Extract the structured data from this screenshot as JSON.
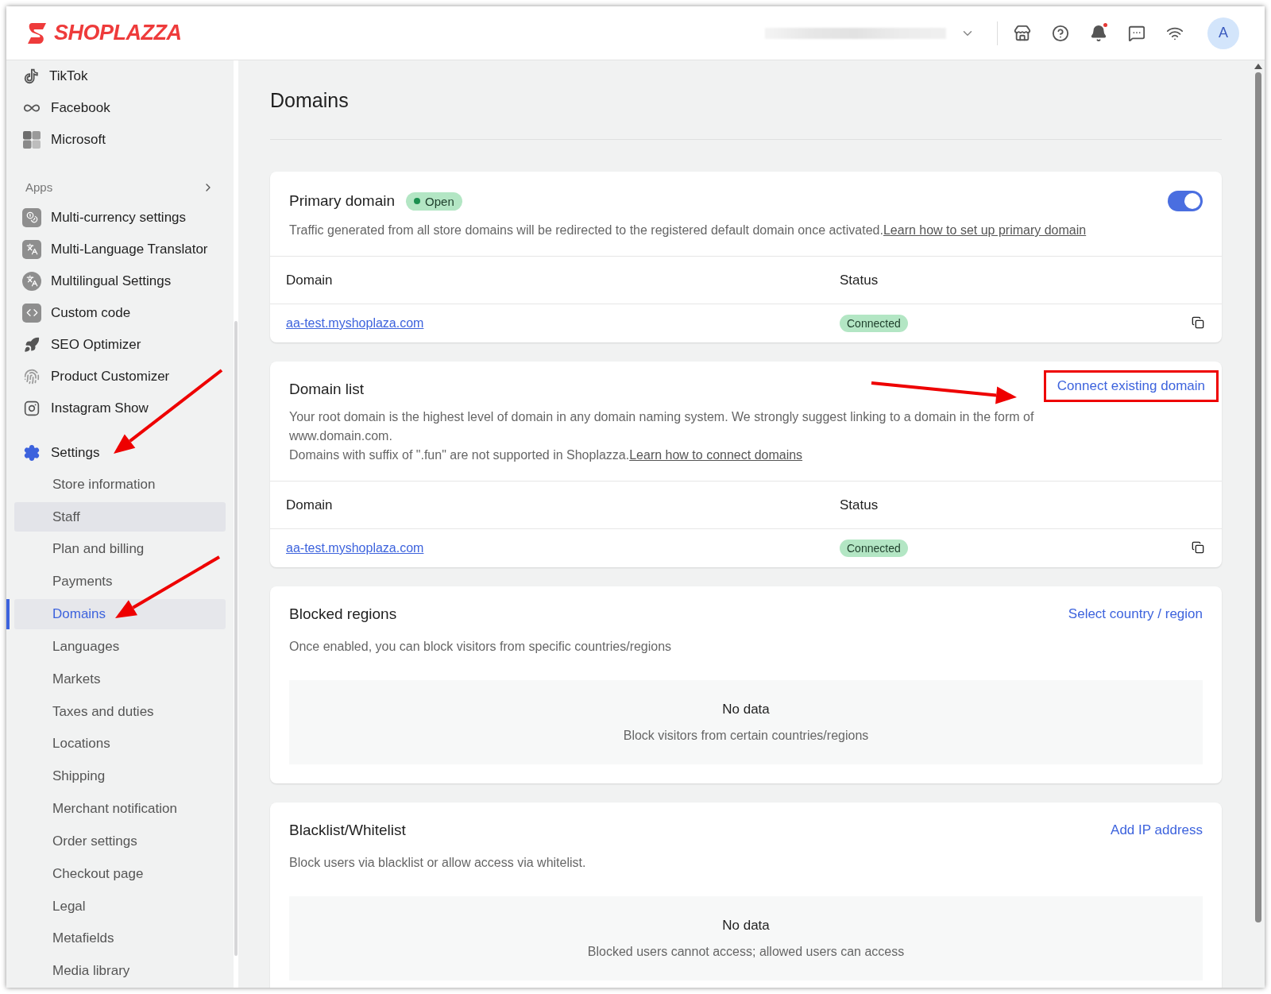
{
  "header": {
    "logo": "SHOPLAZZA",
    "notification_dot": true,
    "avatar": "A"
  },
  "sidebar": {
    "channels": [
      {
        "label": "TikTok"
      },
      {
        "label": "Facebook"
      },
      {
        "label": "Microsoft"
      }
    ],
    "apps_heading": "Apps",
    "apps": [
      {
        "label": "Multi-currency settings"
      },
      {
        "label": "Multi-Language Translator"
      },
      {
        "label": "Multilingual Settings"
      },
      {
        "label": "Custom code"
      },
      {
        "label": "SEO Optimizer"
      },
      {
        "label": "Product Customizer"
      },
      {
        "label": "Instagram Show"
      }
    ],
    "settings": {
      "label": "Settings",
      "items": [
        {
          "label": "Store information",
          "selected": false,
          "highlighted": false
        },
        {
          "label": "Staff",
          "selected": false,
          "highlighted": true
        },
        {
          "label": "Plan and billing",
          "selected": false,
          "highlighted": false
        },
        {
          "label": "Payments",
          "selected": false,
          "highlighted": false
        },
        {
          "label": "Domains",
          "selected": true,
          "highlighted": false
        },
        {
          "label": "Languages",
          "selected": false,
          "highlighted": false
        },
        {
          "label": "Markets",
          "selected": false,
          "highlighted": false
        },
        {
          "label": "Taxes and duties",
          "selected": false,
          "highlighted": false
        },
        {
          "label": "Locations",
          "selected": false,
          "highlighted": false
        },
        {
          "label": "Shipping",
          "selected": false,
          "highlighted": false
        },
        {
          "label": "Merchant notification",
          "selected": false,
          "highlighted": false
        },
        {
          "label": "Order settings",
          "selected": false,
          "highlighted": false
        },
        {
          "label": "Checkout page",
          "selected": false,
          "highlighted": false
        },
        {
          "label": "Legal",
          "selected": false,
          "highlighted": false
        },
        {
          "label": "Metafields",
          "selected": false,
          "highlighted": false
        },
        {
          "label": "Media library",
          "selected": false,
          "highlighted": false
        }
      ]
    }
  },
  "page": {
    "title": "Domains"
  },
  "primary_domain": {
    "title": "Primary domain",
    "badge": "Open",
    "on": true,
    "description": "Traffic generated from all store domains will be redirected to the registered default domain once activated.",
    "link": "Learn how to set up primary domain",
    "columns": [
      "Domain",
      "Status"
    ],
    "rows": [
      {
        "domain": "aa-test.myshoplaza.com",
        "status": "Connected"
      }
    ]
  },
  "domain_list": {
    "title": "Domain list",
    "action": "Connect existing domain",
    "action_highlighted": true,
    "description": "Your root domain is the highest level of domain in any domain naming system. We strongly suggest linking to a domain in the form of www.domain.com.",
    "note": "Domains with suffix of \".fun\" are not supported in Shoplazza.",
    "link": "Learn how to connect domains",
    "columns": [
      "Domain",
      "Status"
    ],
    "rows": [
      {
        "domain": "aa-test.myshoplaza.com",
        "status": "Connected"
      }
    ]
  },
  "blocked_regions": {
    "title": "Blocked regions",
    "action": "Select country / region",
    "description": "Once enabled, you can block visitors from specific countries/regions",
    "empty_title": "No data",
    "empty_text": "Block visitors from certain countries/regions"
  },
  "blacklist": {
    "title": "Blacklist/Whitelist",
    "action": "Add IP address",
    "description": "Block users via blacklist or allow access via whitelist.",
    "empty_title": "No data",
    "empty_text": "Blocked users cannot access; allowed users can access"
  }
}
